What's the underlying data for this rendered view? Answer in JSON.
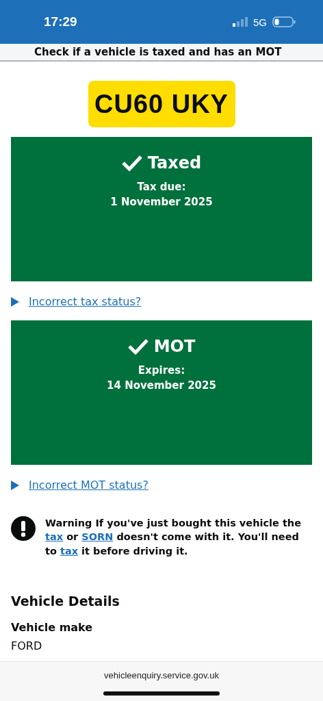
{
  "status_bar": {
    "time": "17:29",
    "network": "5G"
  },
  "page_header": {
    "title": "Check if a vehicle is taxed and has an MOT"
  },
  "registration_plate": "CU60 UKY",
  "status_panels": [
    {
      "title": "Taxed",
      "valid": true,
      "label": "Tax due:",
      "date": "1 November 2025",
      "link": "Incorrect tax status?"
    },
    {
      "title": "MOT",
      "valid": true,
      "label": "Expires:",
      "date": "14 November 2025",
      "link": "Incorrect MOT status?"
    }
  ],
  "warning": {
    "segments": [
      {
        "text": "Warning If you've just bought this vehicle the ",
        "kind": "text"
      },
      {
        "text": "tax",
        "kind": "link"
      },
      {
        "text": " or ",
        "kind": "text"
      },
      {
        "text": "SORN",
        "kind": "link"
      },
      {
        "text": " doesn't come with it. You'll need to ",
        "kind": "text"
      },
      {
        "text": "tax",
        "kind": "link"
      },
      {
        "text": " it before driving it.",
        "kind": "text"
      }
    ]
  },
  "vehicle_details": {
    "heading": "Vehicle Details",
    "rows": [
      {
        "label": "Vehicle make",
        "value": "FORD"
      }
    ]
  },
  "browser_bar": {
    "url": "vehicleenquiry.service.gov.uk"
  }
}
